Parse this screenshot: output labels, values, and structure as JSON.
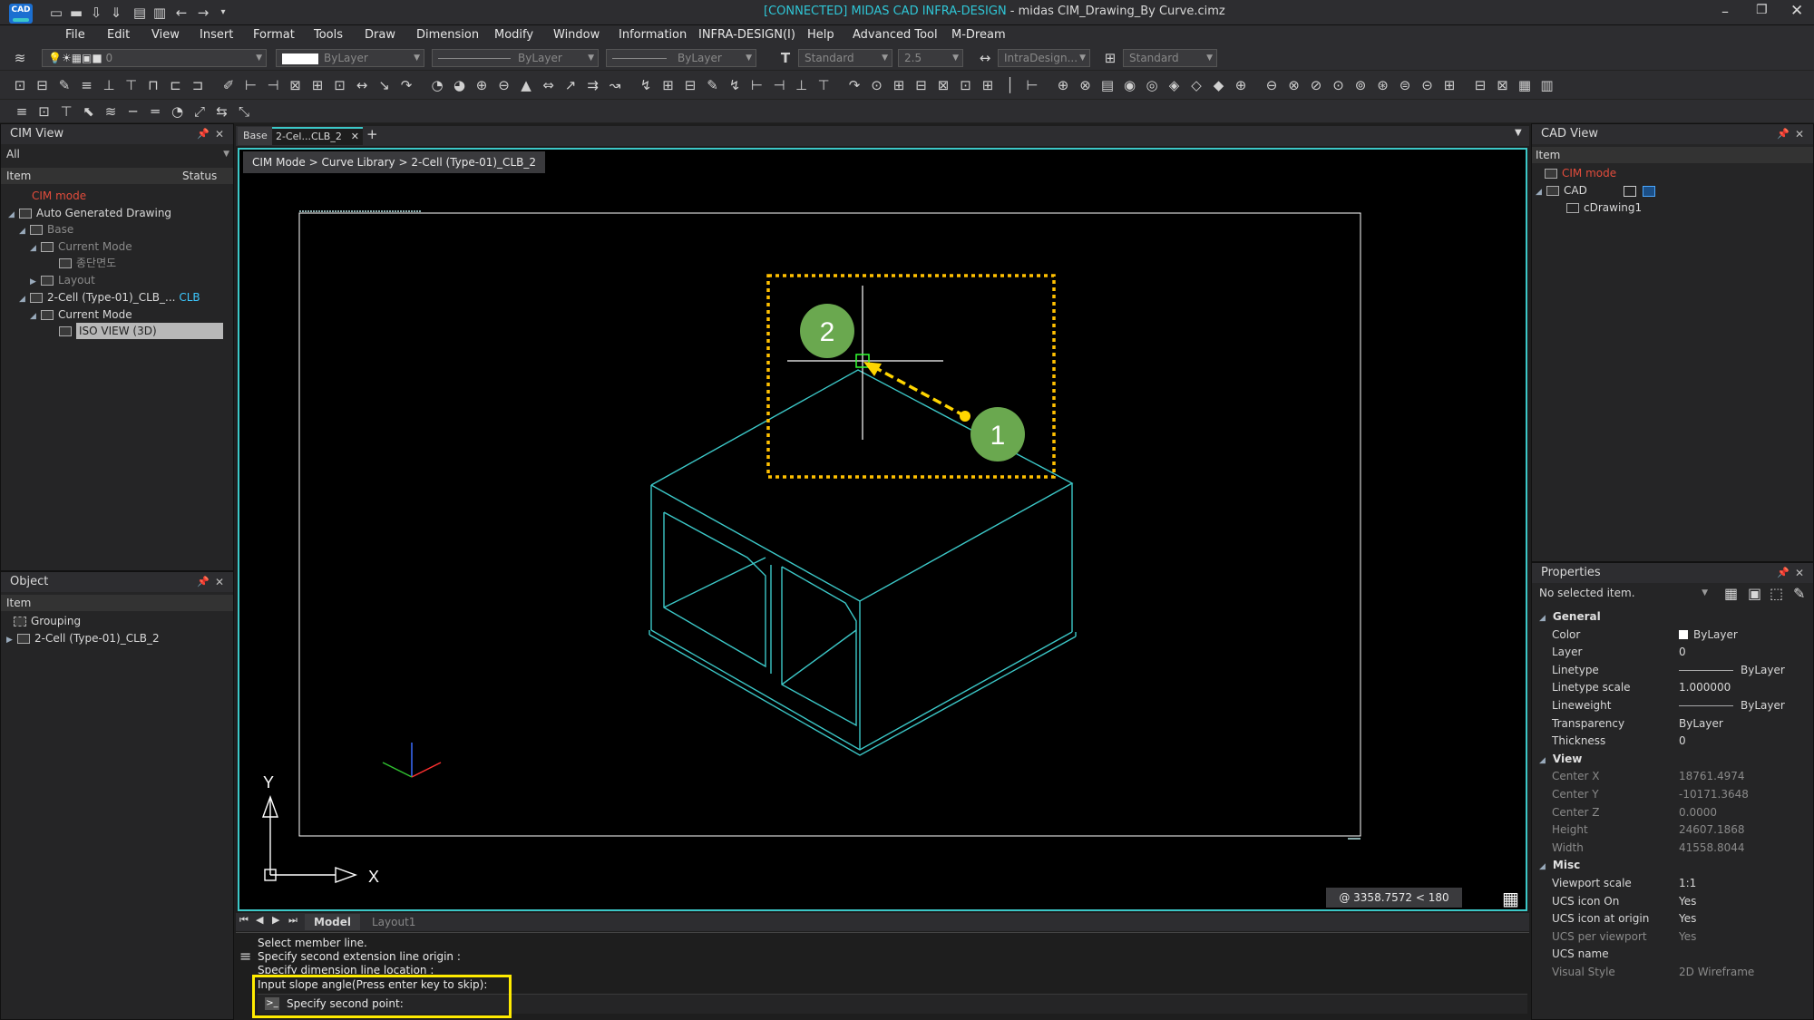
{
  "title": {
    "connected": "[CONNECTED]",
    "app": "MIDAS CAD INFRA-DESIGN",
    "sep": " - ",
    "file": "midas CIM_Drawing_By Curve.cimz",
    "logo": "CAD"
  },
  "menu": [
    "File",
    "Edit",
    "View",
    "Insert",
    "Format",
    "Tools",
    "Draw",
    "Dimension",
    "Modify",
    "Window",
    "Information",
    "INFRA-DESIGN(I)",
    "Help",
    "Advanced Tool",
    "M-Dream"
  ],
  "toolbar": {
    "layer_value": "0",
    "color_value": "ByLayer",
    "linetype_value": "ByLayer",
    "lineweight_value": "ByLayer",
    "textstyle_value": "Standard",
    "textsize_value": "2.5",
    "dimstyle_value": "IntraDesign...",
    "tablestyle_value": "Standard"
  },
  "cim_view": {
    "title": "CIM View",
    "filter": "All",
    "col_item": "Item",
    "col_status": "Status",
    "rows": [
      {
        "label": "CIM mode"
      },
      {
        "label": "Auto Generated Drawing"
      },
      {
        "label": "Base"
      },
      {
        "label": "Current Mode"
      },
      {
        "label": "종단면도"
      },
      {
        "label": "Layout"
      },
      {
        "label": "2-Cell (Type-01)_CLB_..."
      },
      {
        "label": "Current Mode"
      },
      {
        "label": "ISO VIEW (3D)"
      }
    ],
    "status_clb": "CLB"
  },
  "object_panel": {
    "title": "Object",
    "col_item": "Item",
    "rows": [
      {
        "label": "Grouping"
      },
      {
        "label": "2-Cell (Type-01)_CLB_2"
      }
    ]
  },
  "doc_tabs": [
    {
      "label": "Base"
    },
    {
      "label": "2-Cel...CLB_2"
    }
  ],
  "breadcrumb": "CIM Mode > Curve Library > 2-Cell (Type-01)_CLB_2",
  "viewport": {
    "marker1": "1",
    "marker2": "2",
    "ucs_x": "X",
    "ucs_y": "Y",
    "coord_readout": "@ 3358.7572 < 180"
  },
  "layout_tabs": [
    "Model",
    "Layout1"
  ],
  "command": {
    "history": [
      "Select member line.",
      "Specify second extension line origin :",
      "Specify dimension line location :",
      "Input slope angle(Press enter key to skip):"
    ],
    "prompt": "Specify second point:"
  },
  "cad_view": {
    "title": "CAD View",
    "col_item": "Item",
    "rows": [
      {
        "label": "CIM mode"
      },
      {
        "label": "CAD"
      },
      {
        "label": "cDrawing1"
      }
    ]
  },
  "properties": {
    "title": "Properties",
    "selection": "No selected item.",
    "sections": [
      {
        "name": "General",
        "rows": [
          {
            "k": "Color",
            "v": "ByLayer"
          },
          {
            "k": "Layer",
            "v": "0"
          },
          {
            "k": "Linetype",
            "v": "ByLayer"
          },
          {
            "k": "Linetype scale",
            "v": "1.000000"
          },
          {
            "k": "Lineweight",
            "v": "ByLayer"
          },
          {
            "k": "Transparency",
            "v": "ByLayer"
          },
          {
            "k": "Thickness",
            "v": "0"
          }
        ]
      },
      {
        "name": "View",
        "rows": [
          {
            "k": "Center X",
            "v": "18761.4974"
          },
          {
            "k": "Center Y",
            "v": "-10171.3648"
          },
          {
            "k": "Center Z",
            "v": "0.0000"
          },
          {
            "k": "Height",
            "v": "24607.1868"
          },
          {
            "k": "Width",
            "v": "41558.8044"
          }
        ]
      },
      {
        "name": "Misc",
        "rows": [
          {
            "k": "Viewport scale",
            "v": "1:1"
          },
          {
            "k": "UCS icon On",
            "v": "Yes"
          },
          {
            "k": "UCS icon at origin",
            "v": "Yes"
          },
          {
            "k": "UCS per viewport",
            "v": "Yes"
          },
          {
            "k": "UCS name",
            "v": ""
          },
          {
            "k": "Visual Style",
            "v": "2D Wireframe"
          }
        ]
      }
    ]
  },
  "colors": {
    "accent": "#3cc8c8",
    "highlight": "#ffd500",
    "marker": "#6aa84f",
    "title_cyan": "#2fc6d6",
    "red": "#e24c3c"
  }
}
